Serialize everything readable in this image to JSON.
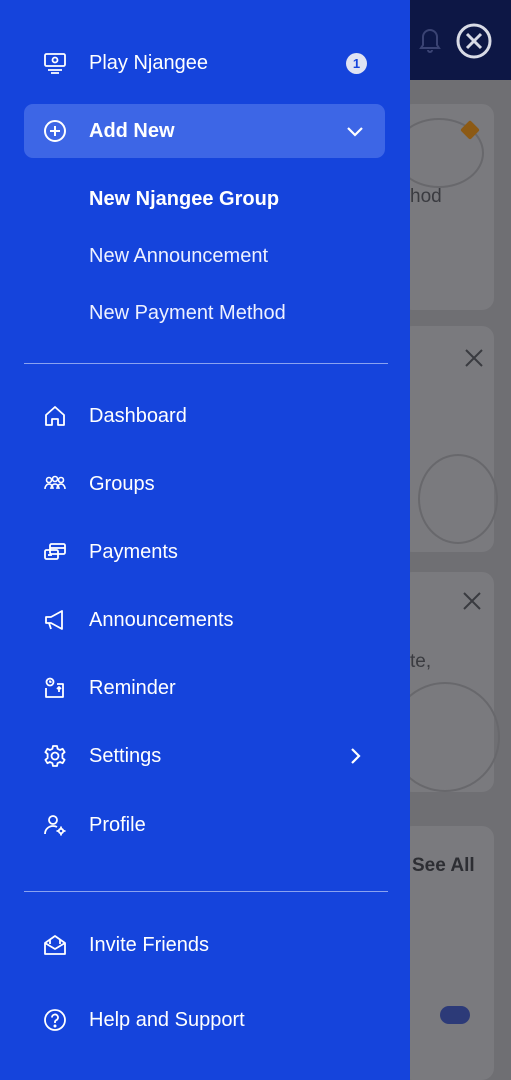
{
  "background": {
    "method_fragment": "hod",
    "te_fragment": "te,",
    "see_all": "See All"
  },
  "drawer": {
    "play": {
      "label": "Play Njangee",
      "badge": "1"
    },
    "add_new": {
      "label": "Add New",
      "children": [
        "New Njangee Group",
        "New Announcement",
        "New Payment Method"
      ]
    },
    "nav": [
      {
        "label": "Dashboard"
      },
      {
        "label": "Groups"
      },
      {
        "label": "Payments"
      },
      {
        "label": "Announcements"
      },
      {
        "label": "Reminder"
      },
      {
        "label": "Settings"
      },
      {
        "label": "Profile"
      }
    ],
    "footer": [
      {
        "label": "Invite Friends"
      },
      {
        "label": "Help and Support"
      }
    ]
  },
  "colors": {
    "drawer_bg": "#1544dc",
    "active_item_bg": "#3d66e6",
    "header_bg": "#0d1745",
    "overlay_bg": "#6f6f73"
  }
}
